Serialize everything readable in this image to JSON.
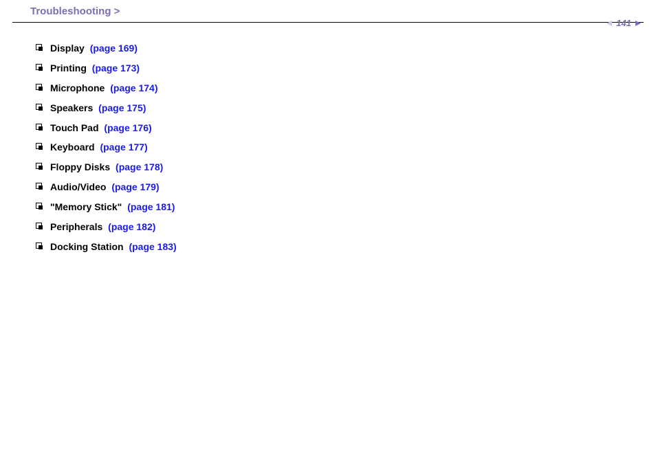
{
  "header": {
    "title": "Troubleshooting >",
    "page_number": "141"
  },
  "items": [
    {
      "label": "Display",
      "link": "(page 169)"
    },
    {
      "label": "Printing",
      "link": "(page 173)"
    },
    {
      "label": "Microphone",
      "link": "(page 174)"
    },
    {
      "label": "Speakers",
      "link": "(page 175)"
    },
    {
      "label": "Touch Pad",
      "link": "(page 176)"
    },
    {
      "label": "Keyboard",
      "link": "(page 177)"
    },
    {
      "label": "Floppy Disks",
      "link": "(page 178)"
    },
    {
      "label": "Audio/Video",
      "link": "(page 179)"
    },
    {
      "label": "\"Memory Stick\"",
      "link": "(page 181)"
    },
    {
      "label": "Peripherals",
      "link": "(page 182)"
    },
    {
      "label": "Docking Station",
      "link": "(page 183)"
    }
  ]
}
